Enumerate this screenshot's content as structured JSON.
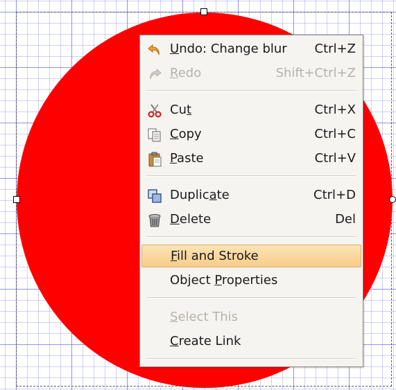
{
  "canvas": {
    "object_color": "#ff0000",
    "grid_color": "#6a6ae6"
  },
  "context_menu": {
    "items": [
      {
        "pre": "",
        "mn": "U",
        "post": "ndo: Change blur",
        "shortcut": "Ctrl+Z",
        "icon": "undo-icon",
        "disabled": false
      },
      {
        "pre": "",
        "mn": "R",
        "post": "edo",
        "shortcut": "Shift+Ctrl+Z",
        "icon": "redo-icon",
        "disabled": true
      },
      {
        "pre": "Cu",
        "mn": "t",
        "post": "",
        "shortcut": "Ctrl+X",
        "icon": "cut-icon",
        "disabled": false
      },
      {
        "pre": "",
        "mn": "C",
        "post": "opy",
        "shortcut": "Ctrl+C",
        "icon": "copy-icon",
        "disabled": false
      },
      {
        "pre": "",
        "mn": "P",
        "post": "aste",
        "shortcut": "Ctrl+V",
        "icon": "paste-icon",
        "disabled": false
      },
      {
        "pre": "Duplic",
        "mn": "a",
        "post": "te",
        "shortcut": "Ctrl+D",
        "icon": "duplicate-icon",
        "disabled": false
      },
      {
        "pre": "",
        "mn": "D",
        "post": "elete",
        "shortcut": "Del",
        "icon": "delete-icon",
        "disabled": false
      },
      {
        "pre": "",
        "mn": "F",
        "post": "ill and Stroke",
        "shortcut": "",
        "icon": "",
        "disabled": false,
        "highlighted": true
      },
      {
        "pre": "Object ",
        "mn": "P",
        "post": "roperties",
        "shortcut": "",
        "icon": "",
        "disabled": false
      },
      {
        "pre": "",
        "mn": "S",
        "post": "elect This",
        "shortcut": "",
        "icon": "",
        "disabled": true
      },
      {
        "pre": "",
        "mn": "C",
        "post": "reate Link",
        "shortcut": "",
        "icon": "",
        "disabled": false
      }
    ],
    "highlight_color": "#f8cc8a"
  }
}
